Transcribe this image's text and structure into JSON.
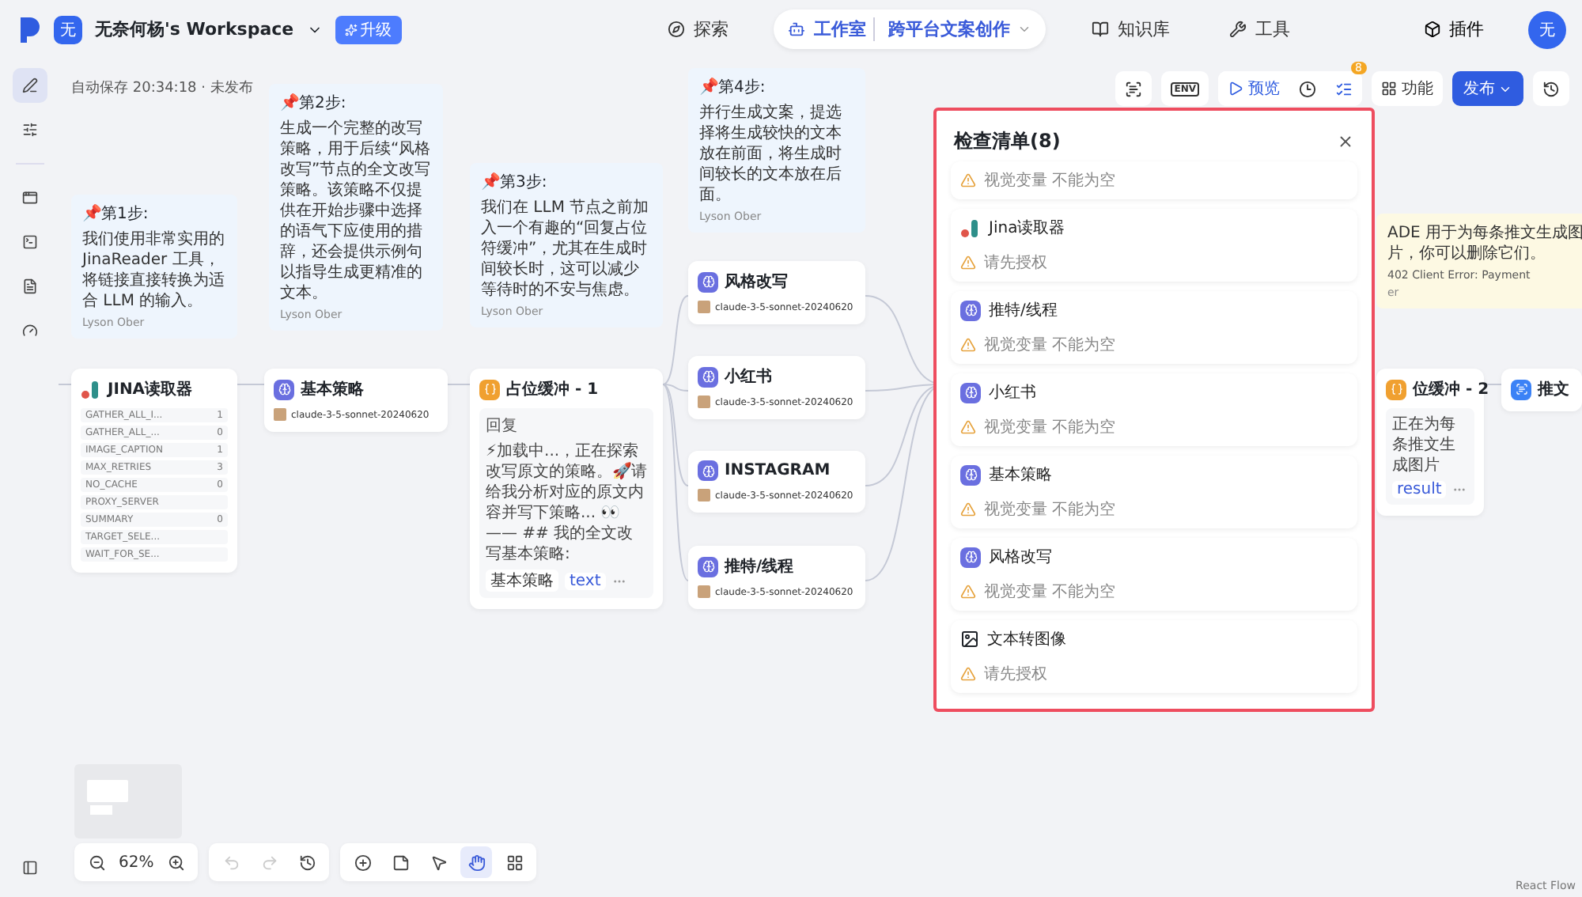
{
  "top_bar": {
    "workspace_avatar": "无",
    "workspace": "无奈何杨's Workspace",
    "upgrade": "升级",
    "nav": [
      {
        "label": "探索",
        "selected": false
      },
      {
        "label": "工作室",
        "selected": true,
        "project": "跨平台文案创作"
      },
      {
        "label": "知识库",
        "selected": false
      },
      {
        "label": "工具",
        "selected": false
      }
    ],
    "plugins": "插件",
    "user_avatar": "无"
  },
  "sidebar": {
    "items": [
      {
        "kind": "edit",
        "selected": true
      },
      {
        "kind": "sliders",
        "selected": false
      },
      {
        "kind": "window",
        "selected": false
      },
      {
        "kind": "terminal",
        "selected": false
      },
      {
        "kind": "file",
        "selected": false
      },
      {
        "kind": "gauge",
        "selected": false
      }
    ]
  },
  "status": "自动保存 20:34:18 · 未发布",
  "toolbar": {
    "env": "ENV",
    "preview": "预览",
    "issues_count": "8",
    "features": "功能",
    "publish": "发布"
  },
  "notes": [
    {
      "title": "📌第1步:",
      "text": "我们使用非常实用的 JinaReader 工具，将链接直接转换为适合 LLM 的输入。",
      "author": "Lyson Ober",
      "color": "#eef5fd"
    },
    {
      "title": "📌第2步:",
      "text": "生成一个完整的改写策略，用于后续“风格改写”节点的全文改写策略。该策略不仅提供在开始步骤中选择的语气下应使用的措辞，还会提供示例句以指导生成更精准的文本。",
      "author": "Lyson Ober",
      "color": "#eef5fd"
    },
    {
      "title": "📌第3步:",
      "text": "我们在 LLM 节点之前加入一个有趣的“回复占位符缓冲”，尤其在生成时间较长时，这可以减少等待时的不安与焦虑。",
      "author": "Lyson Ober",
      "color": "#eef5fd"
    },
    {
      "title": "📌第4步:",
      "text": "并行生成文案，提选择将生成较快的文本放在前面，将生成时间较长的文本放在后面。",
      "author": "Lyson Ober",
      "color": "#eef5fd"
    },
    {
      "text": "ADE 用于为每条推文生成图片，你可以删除它们。",
      "extra": "402 Client Error: Payment",
      "author": "er",
      "color": "#fdf9e3"
    }
  ],
  "nodes": [
    {
      "kind": "tool",
      "title": "JINA读取器",
      "params": [
        {
          "name": "GATHER_ALL_I...",
          "value": "1"
        },
        {
          "name": "GATHER_ALL_...",
          "value": "0"
        },
        {
          "name": "IMAGE_CAPTION",
          "value": "1"
        },
        {
          "name": "MAX_RETRIES",
          "value": "3"
        },
        {
          "name": "NO_CACHE",
          "value": "0"
        },
        {
          "name": "PROXY_SERVER"
        },
        {
          "name": "SUMMARY",
          "value": "0"
        },
        {
          "name": "TARGET_SELE..."
        },
        {
          "name": "WAIT_FOR_SE..."
        }
      ]
    },
    {
      "kind": "llm",
      "title": "基本策略",
      "model": "claude-3-5-sonnet-20240620"
    },
    {
      "kind": "message",
      "title": "占位缓冲 - 1",
      "label": "回复",
      "text": "⚡加载中...，正在探索改写原文的策略。🚀请给我分析对应的原文内容并写下策略... 👀—— ## 我的全文改写基本策略:",
      "chips": [
        "基本策略",
        "text"
      ]
    },
    {
      "kind": "llm",
      "title": "风格改写",
      "model": "claude-3-5-sonnet-20240620"
    },
    {
      "kind": "llm",
      "title": "小红书",
      "model": "claude-3-5-sonnet-20240620"
    },
    {
      "kind": "llm",
      "title": "INSTAGRAM",
      "model": "claude-3-5-sonnet-20240620"
    },
    {
      "kind": "llm",
      "title": "推特/线程",
      "model": "claude-3-5-sonnet-20240620"
    },
    {
      "kind": "message",
      "title": "位缓冲 - 2",
      "text": "正在为每条推文生成图片",
      "chips": [
        "result"
      ]
    },
    {
      "kind": "image",
      "title": "推文"
    }
  ],
  "checklist": {
    "title": "检查清单(8)",
    "items": [
      {
        "message": "视觉变量 不能为空"
      },
      {
        "kind": "tool",
        "name": "Jina读取器",
        "message": "请先授权"
      },
      {
        "kind": "llm",
        "name": "推特/线程",
        "message": "视觉变量 不能为空"
      },
      {
        "kind": "llm",
        "name": "小红书",
        "message": "视觉变量 不能为空"
      },
      {
        "kind": "llm",
        "name": "基本策略",
        "message": "视觉变量 不能为空"
      },
      {
        "kind": "llm",
        "name": "风格改写",
        "message": "视觉变量 不能为空"
      },
      {
        "kind": "image",
        "name": "文本转图像",
        "message": "请先授权"
      }
    ]
  },
  "zoom": "62%",
  "canvas_tools": [
    {
      "kind": "add",
      "selected": false
    },
    {
      "kind": "note",
      "selected": false
    },
    {
      "kind": "pointer",
      "selected": false
    },
    {
      "kind": "hand",
      "selected": true
    },
    {
      "kind": "layout",
      "selected": false
    }
  ],
  "attribution": "React Flow"
}
